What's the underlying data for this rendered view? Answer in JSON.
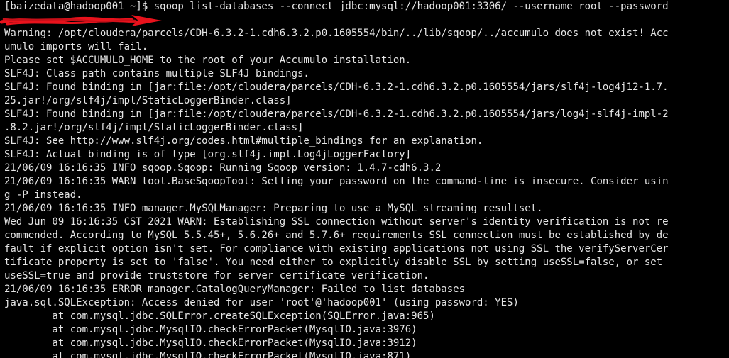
{
  "terminal": {
    "lines": [
      "[baizedata@hadoop001 ~]$ sqoop list-databases --connect jdbc:mysql://hadoop001:3306/ --username root --password",
      "",
      "Warning: /opt/cloudera/parcels/CDH-6.3.2-1.cdh6.3.2.p0.1605554/bin/../lib/sqoop/../accumulo does not exist! Acc",
      "umulo imports will fail.",
      "Please set $ACCUMULO_HOME to the root of your Accumulo installation.",
      "SLF4J: Class path contains multiple SLF4J bindings.",
      "SLF4J: Found binding in [jar:file:/opt/cloudera/parcels/CDH-6.3.2-1.cdh6.3.2.p0.1605554/jars/slf4j-log4j12-1.7.",
      "25.jar!/org/slf4j/impl/StaticLoggerBinder.class]",
      "SLF4J: Found binding in [jar:file:/opt/cloudera/parcels/CDH-6.3.2-1.cdh6.3.2.p0.1605554/jars/log4j-slf4j-impl-2",
      ".8.2.jar!/org/slf4j/impl/StaticLoggerBinder.class]",
      "SLF4J: See http://www.slf4j.org/codes.html#multiple_bindings for an explanation.",
      "SLF4J: Actual binding is of type [org.slf4j.impl.Log4jLoggerFactory]",
      "21/06/09 16:16:35 INFO sqoop.Sqoop: Running Sqoop version: 1.4.7-cdh6.3.2",
      "21/06/09 16:16:35 WARN tool.BaseSqoopTool: Setting your password on the command-line is insecure. Consider usin",
      "g -P instead.",
      "21/06/09 16:16:35 INFO manager.MySQLManager: Preparing to use a MySQL streaming resultset.",
      "Wed Jun 09 16:16:35 CST 2021 WARN: Establishing SSL connection without server's identity verification is not re",
      "commended. According to MySQL 5.5.45+, 5.6.26+ and 5.7.6+ requirements SSL connection must be established by de",
      "fault if explicit option isn't set. For compliance with existing applications not using SSL the verifyServerCer",
      "tificate property is set to 'false'. You need either to explicitly disable SSL by setting useSSL=false, or set",
      "useSSL=true and provide truststore for server certificate verification.",
      "21/06/09 16:16:35 ERROR manager.CatalogQueryManager: Failed to list databases",
      "java.sql.SQLException: Access denied for user 'root'@'hadoop001' (using password: YES)",
      "        at com.mysql.jdbc.SQLError.createSQLException(SQLError.java:965)",
      "        at com.mysql.jdbc.MysqlIO.checkErrorPacket(MysqlIO.java:3976)",
      "        at com.mysql.jdbc.MysqlIO.checkErrorPacket(MysqlIO.java:3912)",
      "        at com.mysql.jdbc.MysqlIO.checkErrorPacket(MysqlIO.java:871)"
    ]
  },
  "colors": {
    "background": "#000000",
    "text": "#e5e5e5",
    "redaction": "#e8121c"
  }
}
